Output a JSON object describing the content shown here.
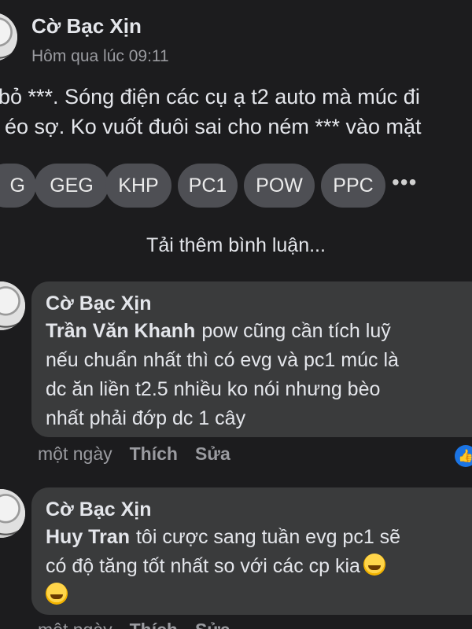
{
  "post": {
    "author": "Cờ Bạc Xịn",
    "time": "Hôm qua lúc 09:11",
    "line1": "bỏ ***. Sóng điện các cụ ạ t2 auto mà múc đi",
    "line2": "éo sợ. Ko vuốt đuôi sai cho ném *** vào mặt"
  },
  "tags": [
    "G",
    "GEG",
    "KHP",
    "PC1",
    "POW",
    "PPC"
  ],
  "more_label": "•••",
  "load_more": "Tải thêm bình luận...",
  "comments": [
    {
      "author": "Cờ Bạc Xịn",
      "mention": "Trần Văn Khanh",
      "lines": [
        "pow cũng cần tích luỹ",
        "nếu chuẩn nhất thì có evg và pc1 múc là",
        "dc ăn liền t2.5 nhiều ko nói nhưng bèo",
        "nhất phải đớp dc 1 cây"
      ],
      "time": "một ngày",
      "like": "Thích",
      "edit": "Sửa",
      "reaction_icon": "thumbs-up-icon"
    },
    {
      "author": "Cờ Bạc Xịn",
      "mention": "Huy Tran",
      "lines": [
        "tôi cược sang tuần evg pc1 sẽ",
        "có độ tăng tốt nhất so với các cp kia"
      ],
      "emoji": "rolling-on-floor-laughing-icon",
      "time": "một ngày",
      "like": "Thích",
      "edit": "Sửa"
    }
  ],
  "colors": {
    "background": "#1c1c1e",
    "bubble": "#3a3b3c",
    "tag": "#4e4f54",
    "muted": "#9a9ba0",
    "like_blue": "#1b74e4"
  }
}
